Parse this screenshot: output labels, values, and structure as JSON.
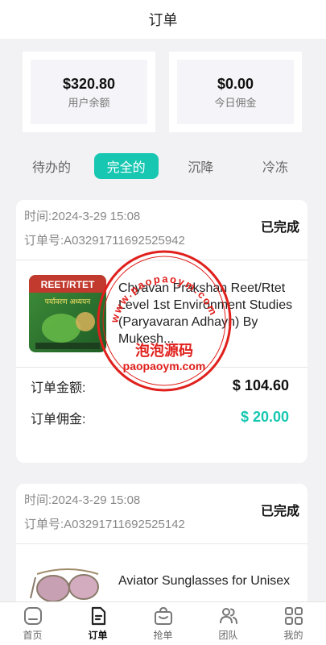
{
  "header": {
    "title": "订单"
  },
  "stats": [
    {
      "value": "$320.80",
      "label": "用户余额"
    },
    {
      "value": "$0.00",
      "label": "今日佣金"
    }
  ],
  "tabs": [
    {
      "label": "待办的",
      "active": false
    },
    {
      "label": "完全的",
      "active": true
    },
    {
      "label": "沉降",
      "active": false
    },
    {
      "label": "冷冻",
      "active": false
    }
  ],
  "orders": [
    {
      "time": "时间:2024-3-29 15:08",
      "order_no": "订单号:A03291711692525942",
      "status": "已完成",
      "product_name": "Chyavan Prakshan Reet/Rtet Level 1st Environment Studies (Paryavaran Adhayn) By Mukesh...",
      "book_cover_text": "REET/RTET",
      "book_cover_subtext": "पर्यावरण अध्ययन",
      "amount_label": "订单金额:",
      "amount_value": "$ 104.60",
      "commission_label": "订单佣金:",
      "commission_value": "$ 20.00"
    },
    {
      "time": "时间:2024-3-29 15:08",
      "order_no": "订单号:A03291711692525142",
      "status": "已完成",
      "product_name": "Aviator Sunglasses for Unisex"
    }
  ],
  "watermark": {
    "text_top": "www.paopaoym.com",
    "text_middle": "泡泡源码",
    "text_bottom": "paopaoym.com",
    "color": "#e0201c"
  },
  "nav": [
    {
      "label": "首页",
      "icon": "home-icon",
      "active": false
    },
    {
      "label": "订单",
      "icon": "order-document-icon",
      "active": true
    },
    {
      "label": "抢单",
      "icon": "shopping-bag-icon",
      "active": false
    },
    {
      "label": "团队",
      "icon": "team-icon",
      "active": false
    },
    {
      "label": "我的",
      "icon": "grid-icon",
      "active": false
    }
  ],
  "colors": {
    "accent": "#17c7b2",
    "background": "#f2f2f4",
    "text": "#222222"
  }
}
